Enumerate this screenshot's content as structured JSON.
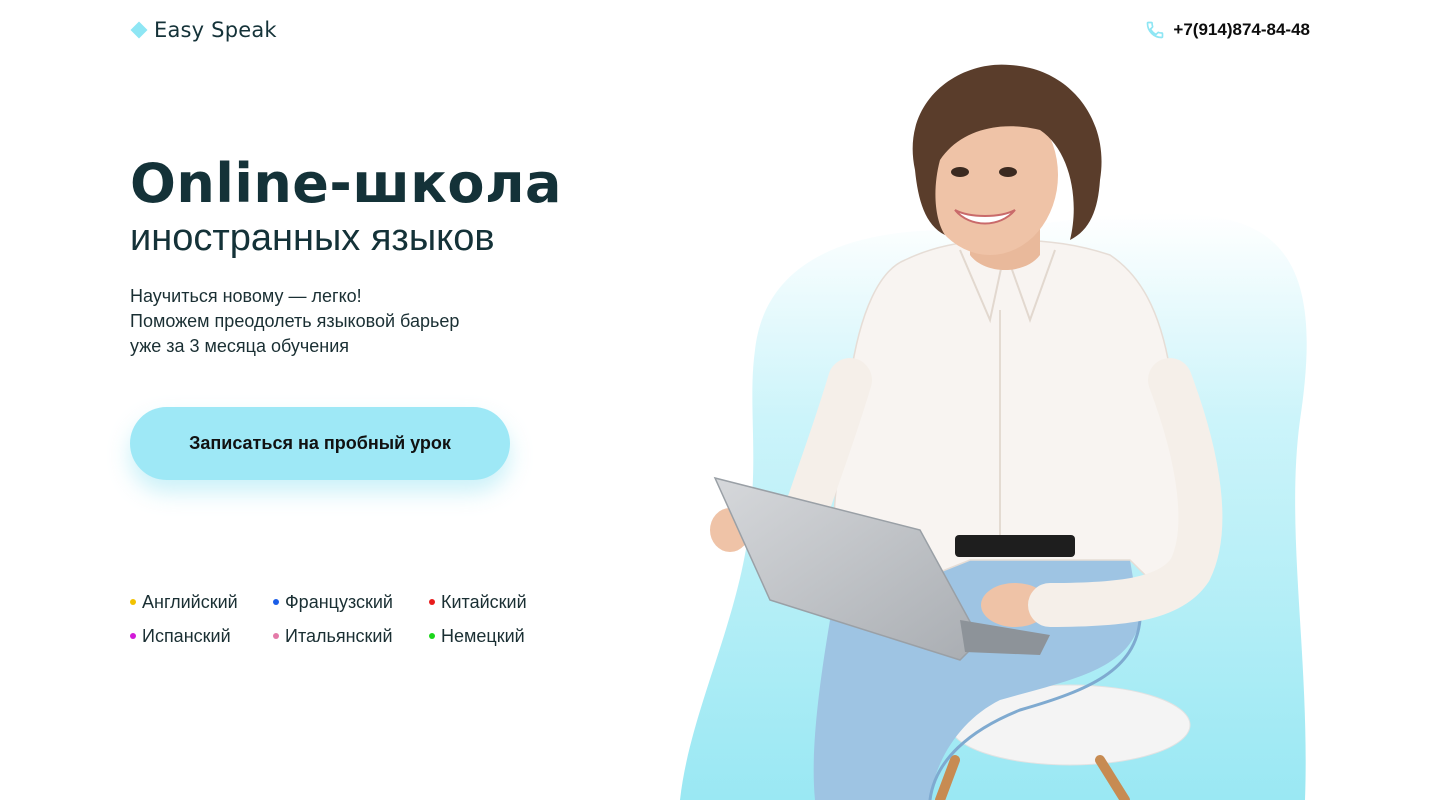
{
  "header": {
    "logo_text": "Easy Speak",
    "phone": "+7(914)874-84-48"
  },
  "hero": {
    "title": "Online-школа",
    "subtitle": "иностранных языков",
    "text_lines": [
      "Научиться новому — легко!",
      "Поможем преодолеть языковой барьер",
      "уже за 3 месяца обучения"
    ],
    "cta_label": "Записаться на пробный урок"
  },
  "languages": [
    {
      "label": "Английский",
      "color": "#f2c200"
    },
    {
      "label": "Французский",
      "color": "#1a5de8"
    },
    {
      "label": "Китайский",
      "color": "#e81b1b"
    },
    {
      "label": "Испанский",
      "color": "#d21ad8"
    },
    {
      "label": "Итальянский",
      "color": "#e47aa8"
    },
    {
      "label": "Немецкий",
      "color": "#1bd61b"
    }
  ],
  "colors": {
    "accent": "#9ee8f6",
    "logo_mark": "#8ee6f4",
    "heading": "#143238"
  }
}
